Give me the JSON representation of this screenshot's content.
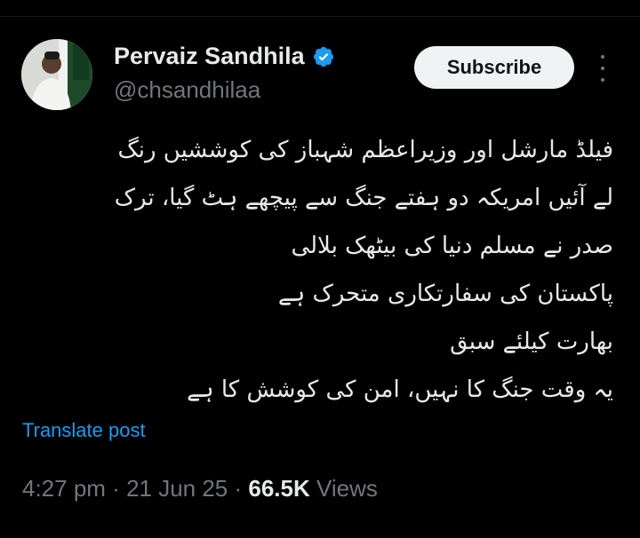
{
  "author": {
    "name": "Pervaiz Sandhila",
    "handle": "@chsandhilaa",
    "verified_icon": "verified-badge-icon",
    "verified_color": "#1d9bf0"
  },
  "actions": {
    "subscribe_label": "Subscribe",
    "more_icon": "more-vertical-icon"
  },
  "post": {
    "lines": [
      "فیلڈ مارشل اور وزیراعظم شہباز کی کوششیں رنگ",
      "لے آئیں امریکہ دو ہفتے جنگ سے پیچھے ہٹ گیا، ترک",
      "صدر نے مسلم دنیا کی بیٹھک بلالی",
      "پاکستان کی سفارتکاری متحرک ہے",
      "بھارت کیلئے سبق",
      "یہ وقت جنگ کا نہیں، امن کی کوشش کا ہے"
    ],
    "translate_label": "Translate post"
  },
  "meta": {
    "time": "4:27 pm",
    "sep1": " · ",
    "date": "21 Jun 25",
    "sep2": " · ",
    "views_count": "66.5K",
    "views_label": " Views"
  },
  "colors": {
    "background": "#000000",
    "text": "#e7e9ea",
    "muted": "#71767b",
    "accent": "#1d9bf0"
  }
}
